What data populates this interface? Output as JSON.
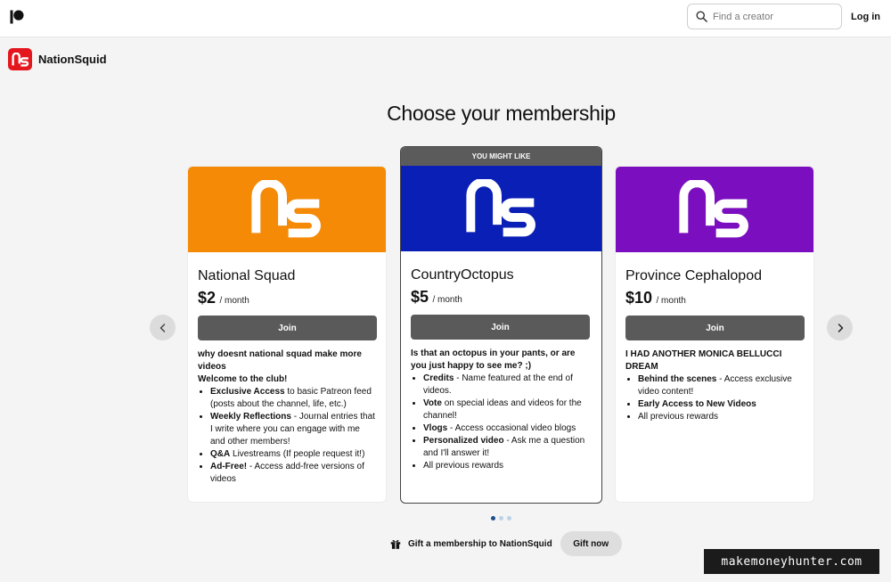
{
  "header": {
    "logo_icon": "patreon-logo-icon",
    "search_placeholder": "Find a creator",
    "login_label": "Log in"
  },
  "creator": {
    "name": "NationSquid",
    "avatar_icon": "nationsquid-logo-icon",
    "avatar_color": "#e4161e"
  },
  "page_title": "Choose your membership",
  "tiers": [
    {
      "name": "National Squad",
      "price": "$2",
      "period": "/ month",
      "join_label": "Join",
      "image_color": "#f58a07",
      "headline": "why doesnt national squad make more videos",
      "subheadline": "Welcome to the club!",
      "benefits": [
        {
          "bold": "Exclusive Access",
          "text": " to basic Patreon feed (posts about the channel, life, etc.)"
        },
        {
          "bold": "Weekly Reflections",
          "text": " - Journal entries that I write where you can engage with me and other members!"
        },
        {
          "bold": "Q&A",
          "text": " Livestreams (If people request it!)"
        },
        {
          "bold": "Ad-Free!",
          "text": " - Access add-free versions of videos"
        }
      ]
    },
    {
      "name": "CountryOctopus",
      "price": "$5",
      "period": "/ month",
      "join_label": "Join",
      "image_color": "#0a1fb5",
      "banner": "YOU MIGHT LIKE",
      "headline": "Is that an octopus in your pants, or are you just happy to see me? ;)",
      "benefits": [
        {
          "bold": "Credits",
          "text": " - Name featured at the end of videos."
        },
        {
          "bold": "Vote",
          "text": " on special ideas and videos for the channel!"
        },
        {
          "bold": "Vlogs",
          "text": " - Access occasional video blogs"
        },
        {
          "bold": "Personalized video",
          "text": " - Ask me a question and I'll answer it!"
        },
        {
          "bold": "",
          "text": "All previous rewards"
        }
      ]
    },
    {
      "name": "Province Cephalopod",
      "price": "$10",
      "period": "/ month",
      "join_label": "Join",
      "image_color": "#7b0fbf",
      "headline": "I HAD ANOTHER MONICA BELLUCCI DREAM",
      "benefits": [
        {
          "bold": "Behind the scenes",
          "text": " - Access exclusive video content!"
        },
        {
          "bold": "Early Access to New Videos",
          "text": ""
        },
        {
          "bold": "",
          "text": "All previous rewards"
        }
      ]
    }
  ],
  "carousel": {
    "prev_icon": "chevron-left-icon",
    "next_icon": "chevron-right-icon",
    "page_count": 3,
    "active_index": 0
  },
  "gift": {
    "icon": "gift-icon",
    "text": "Gift a membership to NationSquid",
    "button_label": "Gift now"
  },
  "watermark": "makemoneyhunter.com"
}
